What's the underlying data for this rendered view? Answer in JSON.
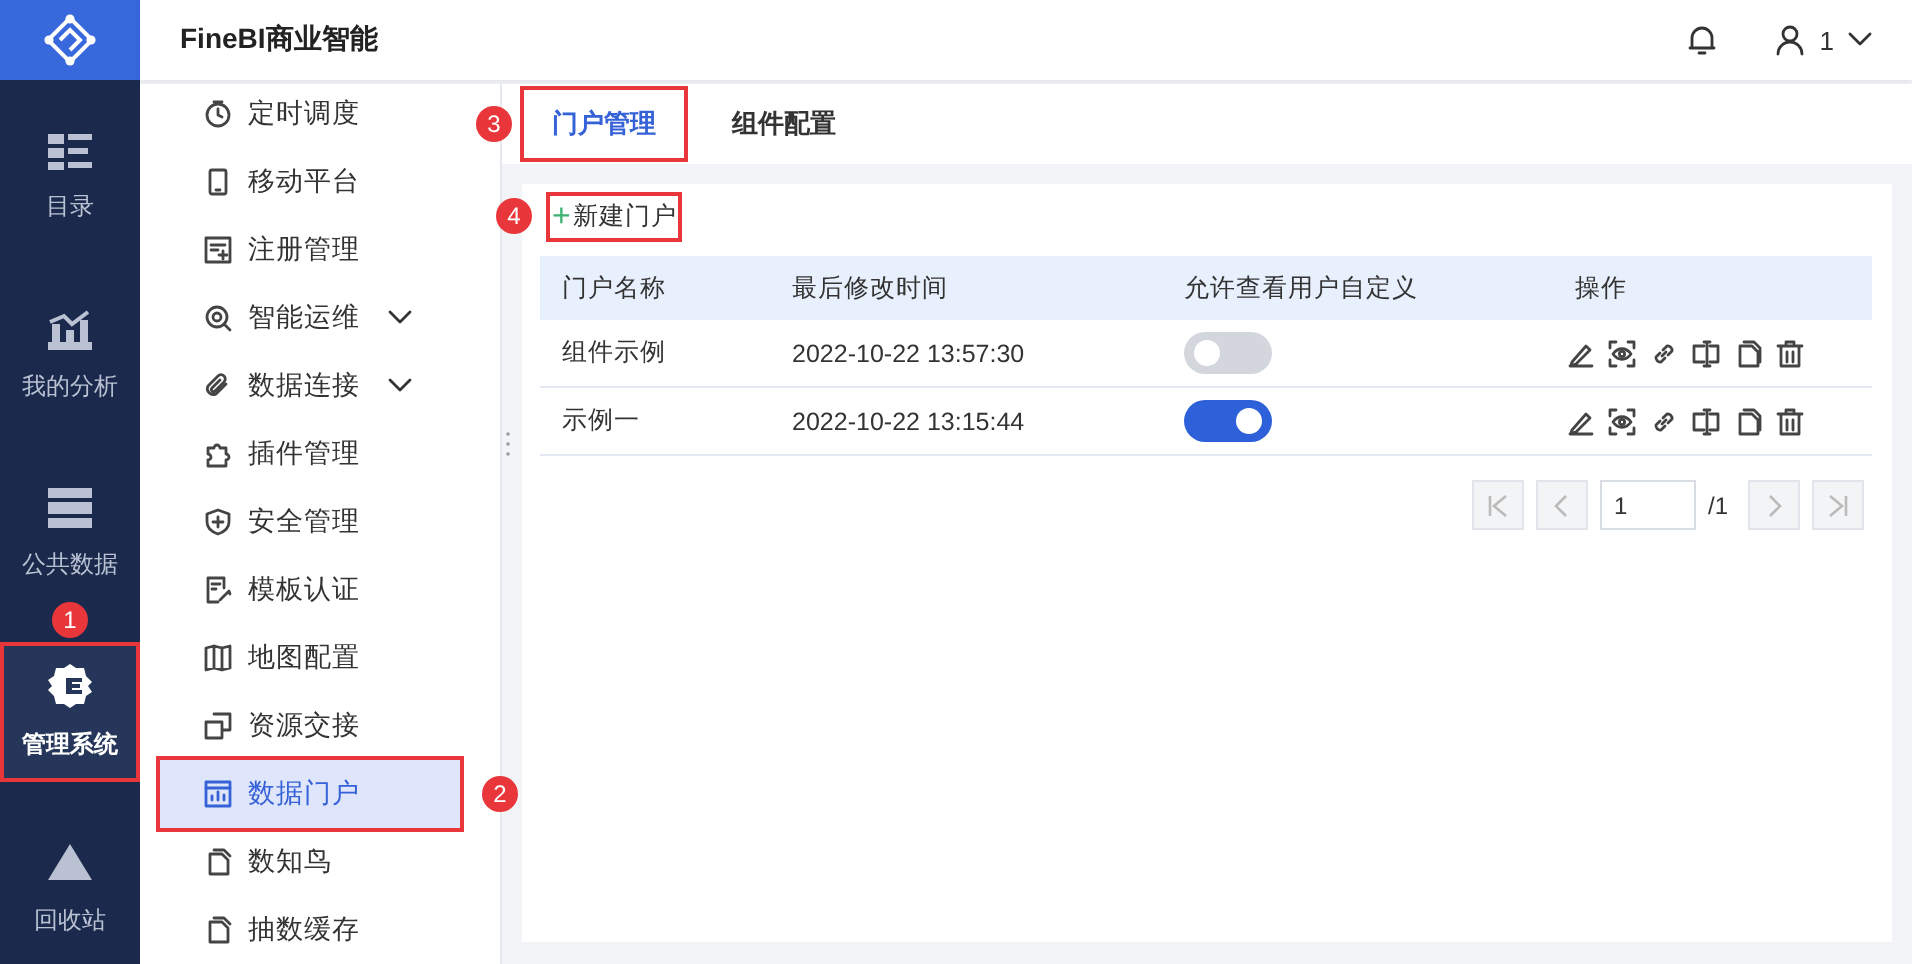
{
  "app": {
    "title": "FineBI商业智能"
  },
  "user": {
    "name": "1"
  },
  "rail": [
    {
      "label": "目录",
      "selected": false
    },
    {
      "label": "我的分析",
      "selected": false
    },
    {
      "label": "公共数据",
      "selected": false
    },
    {
      "label": "管理系统",
      "selected": true,
      "marker": "1"
    },
    {
      "label": "回收站",
      "selected": false
    }
  ],
  "menu": [
    {
      "label": "定时调度",
      "expandable": false,
      "selected": false
    },
    {
      "label": "移动平台",
      "expandable": false,
      "selected": false
    },
    {
      "label": "注册管理",
      "expandable": false,
      "selected": false
    },
    {
      "label": "智能运维",
      "expandable": true,
      "selected": false
    },
    {
      "label": "数据连接",
      "expandable": true,
      "selected": false
    },
    {
      "label": "插件管理",
      "expandable": false,
      "selected": false
    },
    {
      "label": "安全管理",
      "expandable": false,
      "selected": false
    },
    {
      "label": "模板认证",
      "expandable": false,
      "selected": false
    },
    {
      "label": "地图配置",
      "expandable": false,
      "selected": false
    },
    {
      "label": "资源交接",
      "expandable": false,
      "selected": false
    },
    {
      "label": "数据门户",
      "expandable": false,
      "selected": true,
      "marker": "2"
    },
    {
      "label": "数知鸟",
      "expandable": false,
      "selected": false
    },
    {
      "label": "抽数缓存",
      "expandable": false,
      "selected": false
    }
  ],
  "tabs": [
    {
      "label": "门户管理",
      "selected": true,
      "marker": "3"
    },
    {
      "label": "组件配置",
      "selected": false
    }
  ],
  "new_button": {
    "icon": "+",
    "label": "新建门户",
    "marker": "4"
  },
  "table": {
    "columns": [
      "门户名称",
      "最后修改时间",
      "允许查看用户自定义",
      "操作"
    ],
    "rows": [
      {
        "name": "组件示例",
        "modified": "2022-10-22 13:57:30",
        "allow_custom": false
      },
      {
        "name": "示例一",
        "modified": "2022-10-22 13:15:44",
        "allow_custom": true
      }
    ]
  },
  "pagination": {
    "page": "1",
    "total": "/1"
  }
}
